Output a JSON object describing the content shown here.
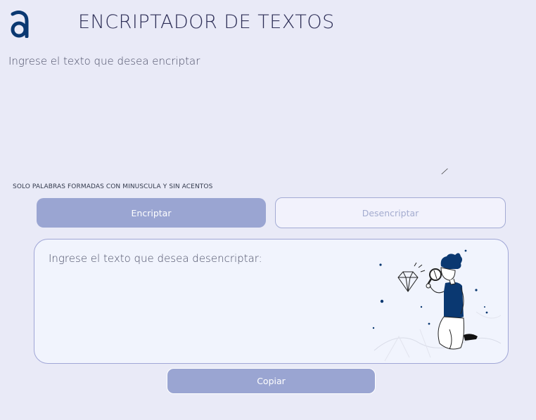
{
  "header": {
    "logo_icon": "alura-a-logo-icon",
    "title": "ENCRIPTADOR DE TEXTOS"
  },
  "input": {
    "placeholder": "Ingrese el texto que desea encriptar",
    "value": ""
  },
  "hint": "SOLO PALABRAS FORMADAS CON MINUSCULA Y SIN ACENTOS",
  "buttons": {
    "encrypt_label": "Encriptar",
    "decrypt_label": "Desencriptar",
    "copy_label": "Copiar"
  },
  "output": {
    "placeholder": "Ingrese el texto que desea desencriptar:",
    "value": "",
    "illustration_icon": "person-magnifier-diamond-illustration-icon"
  },
  "colors": {
    "background": "#e9eaf7",
    "brand": "#0a3871",
    "button_primary": "#9aa5d2",
    "button_secondary_text": "#a4accf",
    "box_background": "#f1f4fd",
    "box_border": "#a0a6d6"
  }
}
